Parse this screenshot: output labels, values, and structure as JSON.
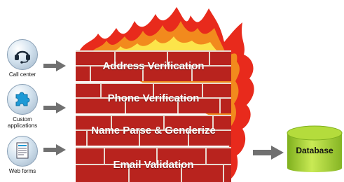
{
  "sources": [
    {
      "label": "Call center",
      "icon": "headset-icon"
    },
    {
      "label": "Custom\napplications",
      "icon": "puzzle-icon"
    },
    {
      "label": "Web forms",
      "icon": "document-form-icon"
    }
  ],
  "wall": {
    "layers": [
      "Address Verification",
      "Phone Verification",
      "Name Parse & Genderize",
      "Email Validation"
    ]
  },
  "database": {
    "label": "Database"
  },
  "colors": {
    "brick": "#b8231e",
    "mortar": "#e8d8cf",
    "flame_red": "#e82a1c",
    "flame_orange": "#f28a1d",
    "flame_yellow": "#fce44a",
    "arrow": "#707070",
    "db_green_light": "#c9ea55",
    "db_green_dark": "#7fb01e"
  }
}
